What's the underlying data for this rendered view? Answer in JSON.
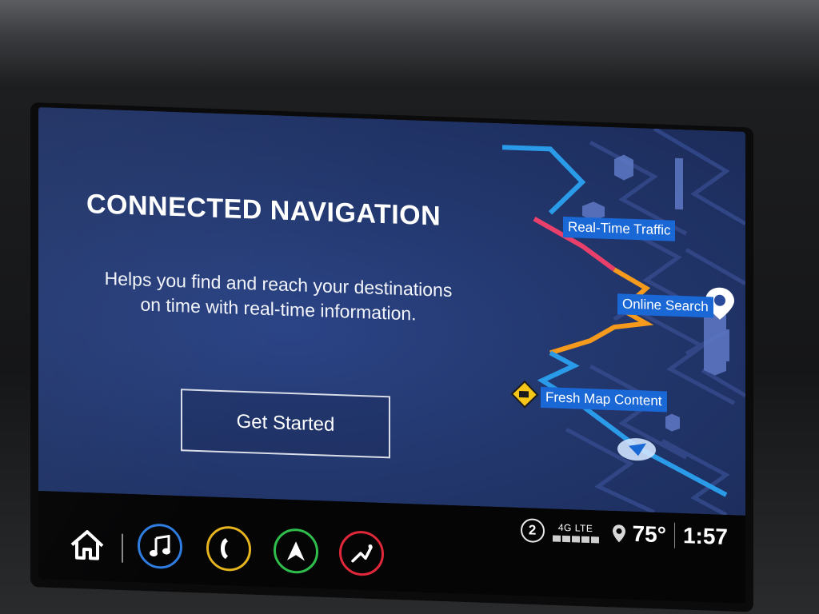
{
  "screen": {
    "title": "CONNECTED NAVIGATION",
    "description": "Helps you find and reach your destinations on time with real-time information.",
    "primary_button": "Get Started"
  },
  "map_features": [
    {
      "label": "Real-Time Traffic"
    },
    {
      "label": "Online Search"
    },
    {
      "label": "Fresh Map Content"
    }
  ],
  "status": {
    "notifications": "2",
    "network": "4G LTE",
    "temperature": "75°",
    "time": "1:57"
  },
  "dock": [
    {
      "name": "home",
      "icon": "home-icon"
    },
    {
      "name": "audio",
      "icon": "music-note-icon",
      "color": "#2f7de1"
    },
    {
      "name": "phone",
      "icon": "phone-icon",
      "color": "#e6b41e"
    },
    {
      "name": "navigation",
      "icon": "navigation-arrow-icon",
      "color": "#2fbe4b"
    },
    {
      "name": "settings",
      "icon": "seat-icon",
      "color": "#e0283a"
    }
  ],
  "colors": {
    "screen_blue": "#23386f",
    "label_blue": "#1a67d6",
    "route_blue": "#2a9be8",
    "route_red": "#e8406a",
    "route_orange": "#f59a1c"
  }
}
